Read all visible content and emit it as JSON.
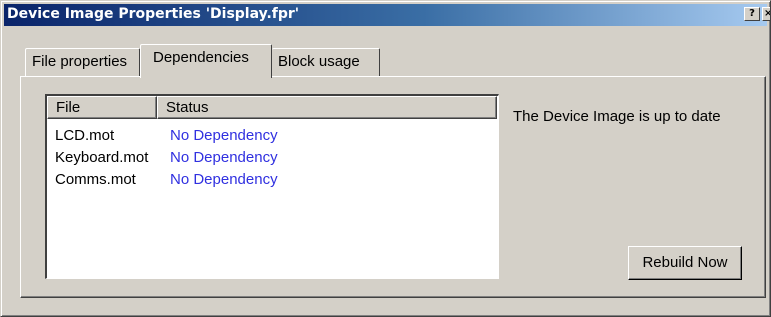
{
  "window": {
    "title": "Device Image Properties 'Display.fpr'",
    "help_glyph": "?",
    "close_glyph": "×"
  },
  "tabs": [
    {
      "label": "File properties",
      "selected": false
    },
    {
      "label": "Dependencies",
      "selected": true
    },
    {
      "label": "Block usage",
      "selected": false
    }
  ],
  "list": {
    "columns": [
      "File",
      "Status"
    ],
    "rows": [
      {
        "file": "LCD.mot",
        "status": "No Dependency"
      },
      {
        "file": "Keyboard.mot",
        "status": "No Dependency"
      },
      {
        "file": "Comms.mot",
        "status": "No Dependency"
      }
    ]
  },
  "status_message": "The Device Image is up to date",
  "rebuild_button": "Rebuild Now",
  "colors": {
    "title_start": "#0a246a",
    "title_end": "#a6caf0",
    "dialog_face": "#d4d0c8",
    "status_link": "#3030e0"
  }
}
